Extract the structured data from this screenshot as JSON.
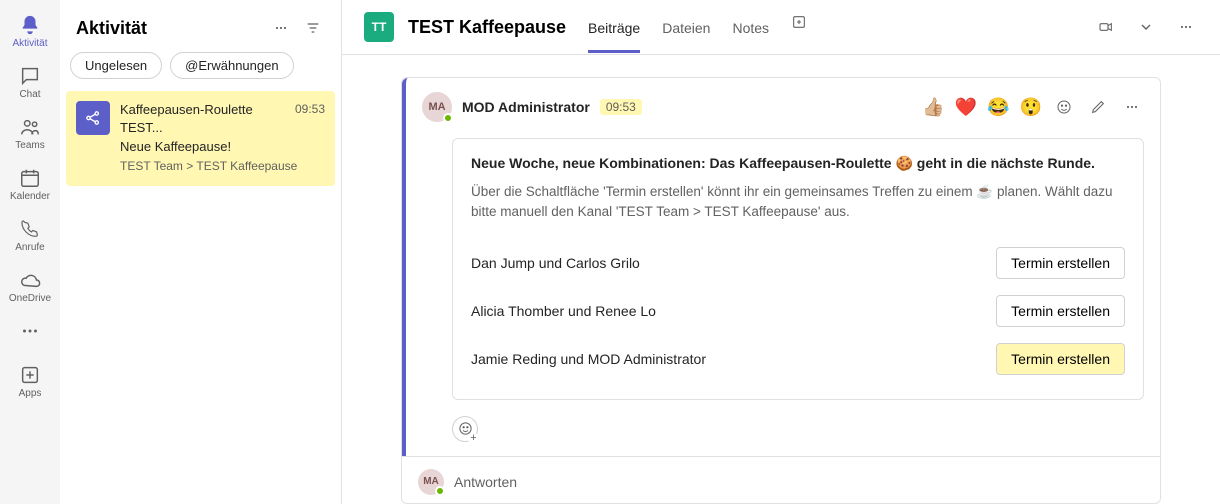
{
  "rail": {
    "items": [
      {
        "label": "Aktivität"
      },
      {
        "label": "Chat"
      },
      {
        "label": "Teams"
      },
      {
        "label": "Kalender"
      },
      {
        "label": "Anrufe"
      },
      {
        "label": "OneDrive"
      },
      {
        "label": "Apps"
      }
    ]
  },
  "activity": {
    "title": "Aktivität",
    "filters": {
      "unread": "Ungelesen",
      "mentions": "@Erwähnungen"
    },
    "item": {
      "title": "Kaffeepausen-Roulette TEST...",
      "subtitle": "Neue Kaffeepause!",
      "path": "TEST Team > TEST Kaffeepause",
      "time": "09:53"
    }
  },
  "channel": {
    "avatar": "TT",
    "title": "TEST Kaffeepause",
    "tabs": [
      {
        "label": "Beiträge",
        "active": true
      },
      {
        "label": "Dateien"
      },
      {
        "label": "Notes"
      }
    ]
  },
  "post": {
    "author_initials": "MA",
    "author": "MOD Administrator",
    "time": "09:53",
    "reactions": [
      "👍🏼",
      "❤️",
      "😂",
      "😲"
    ],
    "card": {
      "heading": "Neue Woche, neue Kombinationen: Das Kaffeepausen-Roulette 🍪 geht in die nächste Runde.",
      "description": "Über die Schaltfläche 'Termin erstellen' könnt ihr ein gemeinsames Treffen zu einem ☕ planen. Wählt dazu bitte manuell den Kanal 'TEST Team > TEST Kaffeepause' aus.",
      "button_label": "Termin erstellen",
      "pairs": [
        "Dan Jump und Carlos Grilo",
        "Alicia Thomber und Renee Lo",
        "Jamie Reding und MOD Administrator"
      ]
    },
    "reply_label": "Antworten"
  }
}
